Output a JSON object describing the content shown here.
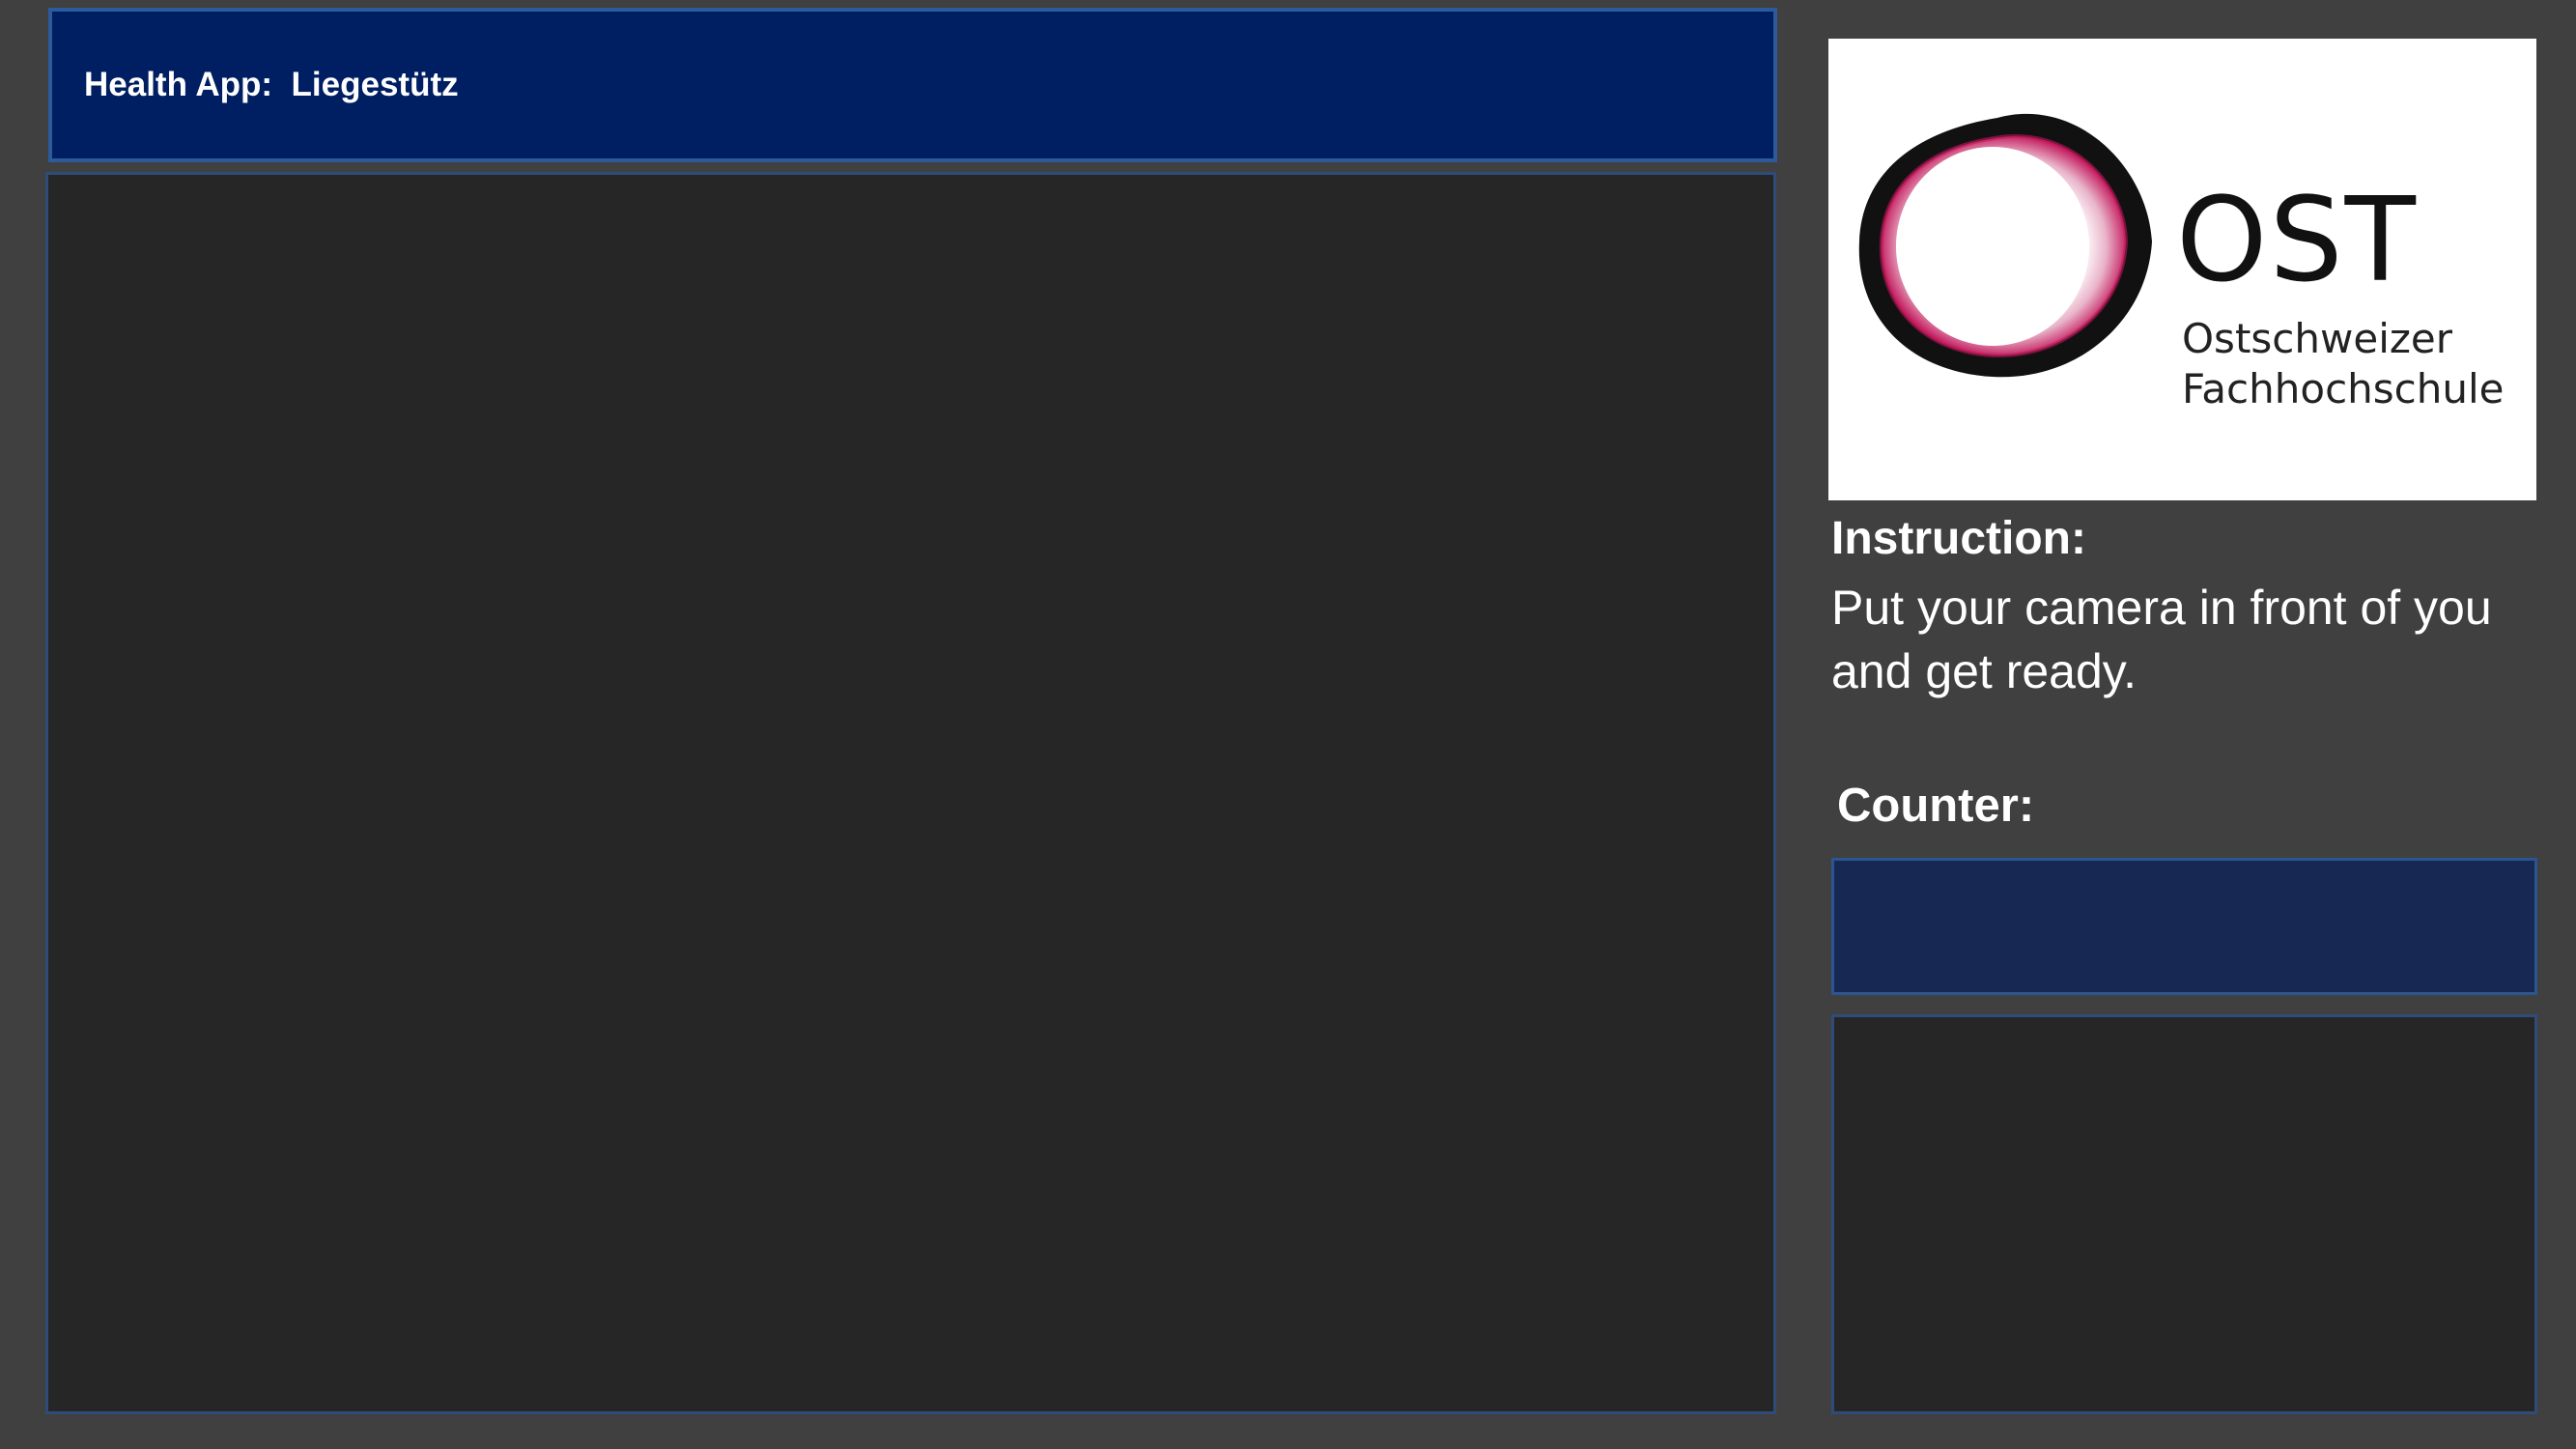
{
  "header": {
    "title": "Health App:  Liegestütz"
  },
  "logo": {
    "main_text": "OST",
    "sub_line_1": "Ostschweizer",
    "sub_line_2": "Fachhochschule"
  },
  "instruction": {
    "title": "Instruction:",
    "text": "Put your camera in front of you and get ready."
  },
  "counter": {
    "title": "Counter:",
    "value": ""
  },
  "colors": {
    "background": "#404040",
    "header_bg": "#001e62",
    "panel_bg": "#262626",
    "counter_bg": "#172952",
    "logo_ring_dark": "#111111",
    "logo_ring_magenta": "#c2185b"
  }
}
